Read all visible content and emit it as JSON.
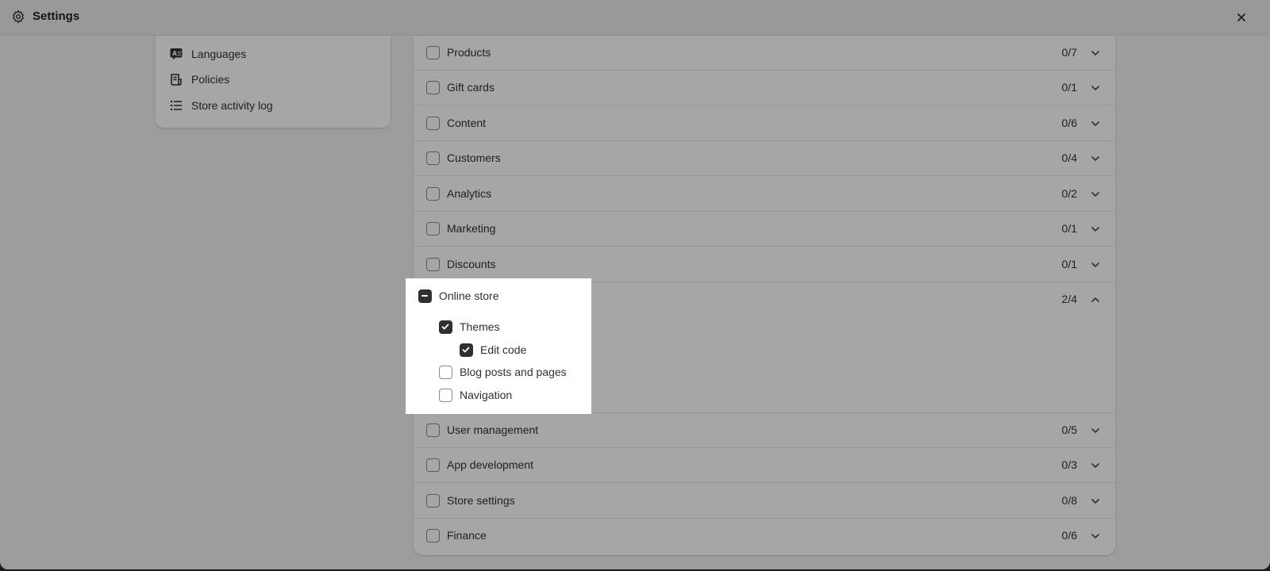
{
  "window": {
    "title": "Settings"
  },
  "sidebar": {
    "items": [
      {
        "label": "Languages",
        "icon": "languages-icon"
      },
      {
        "label": "Policies",
        "icon": "policies-icon"
      },
      {
        "label": "Store activity log",
        "icon": "list-icon"
      }
    ]
  },
  "permissions": {
    "rows": [
      {
        "label": "Products",
        "count": "0/7",
        "checked": false
      },
      {
        "label": "Gift cards",
        "count": "0/1",
        "checked": false
      },
      {
        "label": "Content",
        "count": "0/6",
        "checked": false
      },
      {
        "label": "Customers",
        "count": "0/4",
        "checked": false
      },
      {
        "label": "Analytics",
        "count": "0/2",
        "checked": false
      },
      {
        "label": "Marketing",
        "count": "0/1",
        "checked": false
      },
      {
        "label": "Discounts",
        "count": "0/1",
        "checked": false
      },
      {
        "label": "Online store",
        "count": "2/4",
        "checked": "indeterminate",
        "expanded": true
      },
      {
        "label": "User management",
        "count": "0/5",
        "checked": false
      },
      {
        "label": "App development",
        "count": "0/3",
        "checked": false
      },
      {
        "label": "Store settings",
        "count": "0/8",
        "checked": false
      },
      {
        "label": "Finance",
        "count": "0/6",
        "checked": false
      }
    ],
    "online_store_children": [
      {
        "label": "Themes",
        "checked": true
      },
      {
        "label": "Edit code",
        "checked": true
      },
      {
        "label": "Blog posts and pages",
        "checked": false
      },
      {
        "label": "Navigation",
        "checked": false
      }
    ]
  },
  "colors": {
    "checkbox_on": "#303030",
    "overlay": "rgba(0,0,0,0.35)"
  }
}
